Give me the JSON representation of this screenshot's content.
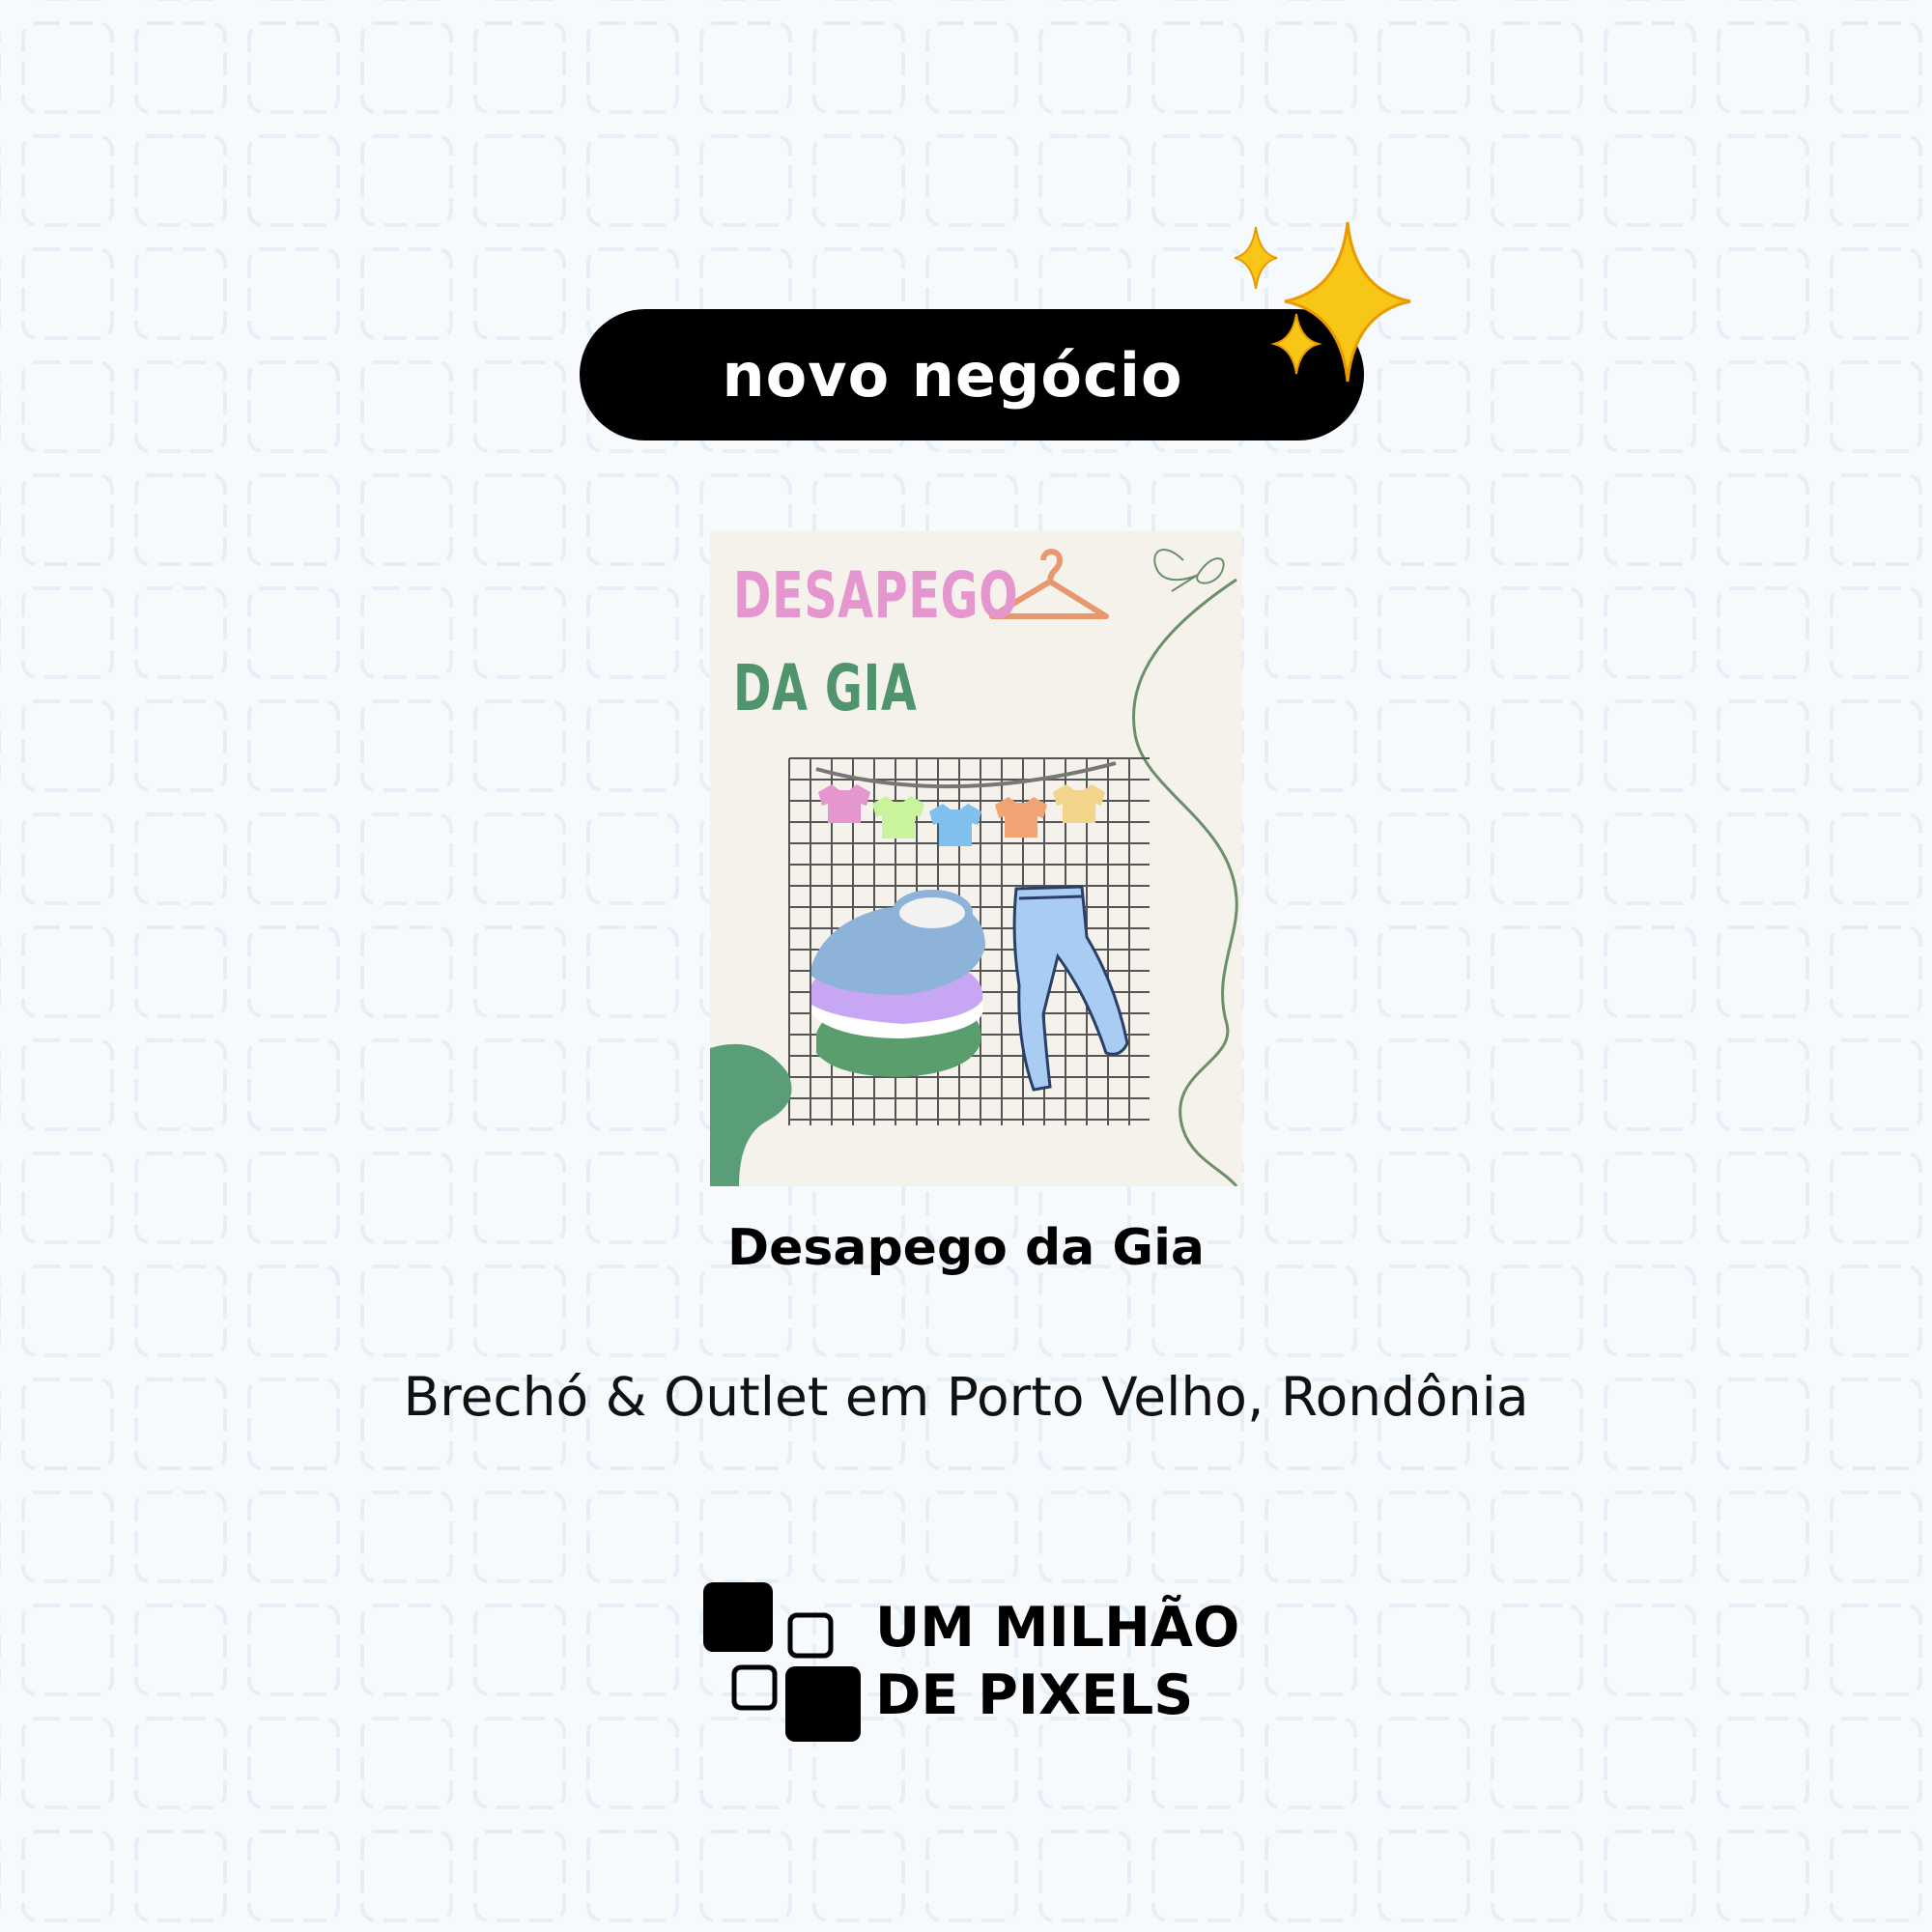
{
  "badge": {
    "label": "novo negócio",
    "sparkle_icon": "sparkles-icon"
  },
  "poster": {
    "title_line1": "DESAPEGO",
    "title_line2": "DA GIA",
    "colors": {
      "pink": "#e596cf",
      "green": "#4f946c",
      "background": "#f4f2eb"
    }
  },
  "business": {
    "name": "Desapego da Gia",
    "description": "Brechó & Outlet em Porto Velho, Rondônia"
  },
  "brand": {
    "line1": "UM MILHÃO",
    "line2": "DE PIXELS"
  },
  "colors": {
    "page_background": "#f7fafd",
    "pattern": "#e6eef7",
    "badge": "#000000"
  }
}
